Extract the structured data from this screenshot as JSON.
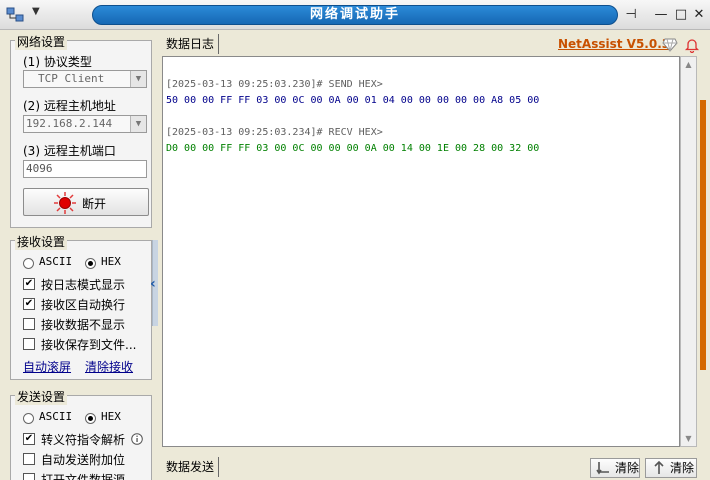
{
  "window": {
    "title": "网络调试助手",
    "brand": "NetAssist V5.0.3",
    "colors": {
      "title_bar": "#1a73c3",
      "brand": "#c85000"
    }
  },
  "network": {
    "group_title": "网络设置",
    "protocol_label": "(1) 协议类型",
    "protocol_value": "TCP Client",
    "host_label": "(2) 远程主机地址",
    "host_value": "192.168.2.144",
    "port_label": "(3) 远程主机端口",
    "port_value": "4096",
    "connect_button": "断开"
  },
  "receive": {
    "group_title": "接收设置",
    "mode_ascii": "ASCII",
    "mode_hex": "HEX",
    "selected_mode": "HEX",
    "options": [
      {
        "label": "按日志模式显示",
        "checked": true
      },
      {
        "label": "接收区自动换行",
        "checked": true
      },
      {
        "label": "接收数据不显示",
        "checked": false
      },
      {
        "label": "接收保存到文件...",
        "checked": false
      }
    ],
    "auto_clear_link": "自动滚屏",
    "clear_link": "清除接收"
  },
  "send": {
    "group_title": "发送设置",
    "mode_ascii": "ASCII",
    "mode_hex": "HEX",
    "selected_mode": "HEX",
    "options": [
      {
        "label": "转义符指令解析",
        "checked": true
      },
      {
        "label": "自动发送附加位",
        "checked": false
      },
      {
        "label": "打开文件数据源",
        "checked": false
      }
    ]
  },
  "log_panel": {
    "tab_label": "数据日志",
    "entries": [
      {
        "stamp": "[2025-03-13 09:25:03.230]# SEND HEX>",
        "data": "50 00 00 FF FF 03 00 0C 00 0A 00 01 04 00 00 00 00 00 A8 05 00",
        "kind": "send"
      },
      {
        "stamp": "[2025-03-13 09:25:03.234]# RECV HEX>",
        "data": "D0 00 00 FF FF 03 00 0C 00 00 00 0A 00 14 00 1E 00 28 00 32 00",
        "kind": "recv"
      }
    ]
  },
  "send_panel": {
    "tab_label": "数据发送",
    "clear_button_1": "清除",
    "clear_button_2": "清除"
  }
}
